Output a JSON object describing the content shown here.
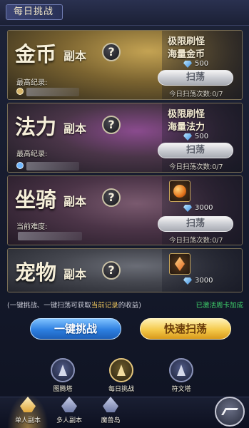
{
  "header": {
    "title": "每日挑战"
  },
  "cards": [
    {
      "name": "金币",
      "suffix": "副本",
      "help": "?",
      "record_label": "最高纪录:",
      "reward_line1": "极限刷怪",
      "reward_line2": "海量金币",
      "cost": "500",
      "sweep_label": "扫荡",
      "times": "今日扫荡次数:0/7",
      "colors": {
        "bg_from": "#6b5a2c",
        "bg_mid": "#a88a3f",
        "bg_to": "#2d2a20"
      }
    },
    {
      "name": "法力",
      "suffix": "副本",
      "help": "?",
      "record_label": "最高纪录:",
      "reward_line1": "极限刷怪",
      "reward_line2": "海量法力",
      "cost": "500",
      "sweep_label": "扫荡",
      "times": "今日扫荡次数:0/7",
      "colors": {
        "bg_from": "#3b3740",
        "bg_mid": "#5c3a66",
        "bg_to": "#1e1d26"
      }
    },
    {
      "name": "坐骑",
      "suffix": "副本",
      "help": "?",
      "record_label": "当前难度:",
      "item": "orange-orb",
      "cost": "3000",
      "sweep_label": "扫荡",
      "times": "今日扫荡次数:0/7",
      "colors": {
        "bg_from": "#4a3446",
        "bg_mid": "#6a4a5e",
        "bg_to": "#221a26"
      }
    },
    {
      "name": "宠物",
      "suffix": "副本",
      "help": "?",
      "item": "orange-shard",
      "cost": "3000",
      "colors": {
        "bg_from": "#3e4048",
        "bg_mid": "#5a5d66",
        "bg_to": "#24262e"
      }
    }
  ],
  "info": {
    "text_before": "(一键挑战、一键扫荡可获取",
    "highlight": "当前记录",
    "text_after": "的收益)",
    "active_card": "已激活周卡加成"
  },
  "buttons": {
    "challenge": "一键挑战",
    "quick_sweep": "快速扫荡"
  },
  "modes": [
    {
      "label": "图腾塔",
      "icon": "totem-tower-icon"
    },
    {
      "label": "每日挑战",
      "icon": "daily-challenge-icon"
    },
    {
      "label": "符文塔",
      "icon": "rune-tower-icon"
    }
  ],
  "tabs": [
    {
      "label": "单人副本",
      "icon": "solo-dungeon-icon"
    },
    {
      "label": "多人副本",
      "icon": "team-dungeon-icon"
    },
    {
      "label": "魔兽岛",
      "icon": "beast-island-icon"
    }
  ]
}
